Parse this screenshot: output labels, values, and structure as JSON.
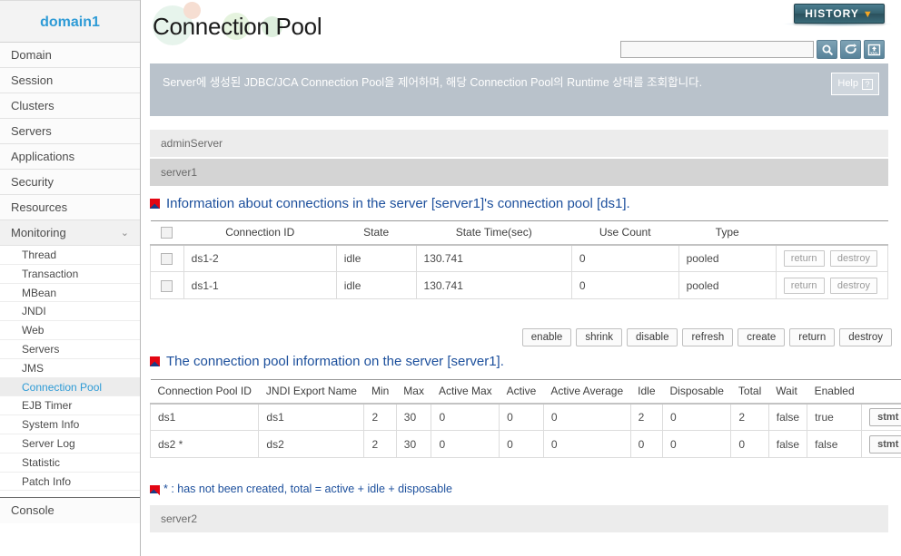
{
  "sidebar": {
    "domain_title": "domain1",
    "top_items": [
      {
        "label": "Domain"
      },
      {
        "label": "Session"
      },
      {
        "label": "Clusters"
      },
      {
        "label": "Servers"
      },
      {
        "label": "Applications"
      },
      {
        "label": "Security"
      },
      {
        "label": "Resources"
      }
    ],
    "monitoring": {
      "label": "Monitoring",
      "chevron": "⌄"
    },
    "sub_items": [
      {
        "label": "Thread",
        "active": false
      },
      {
        "label": "Transaction",
        "active": false
      },
      {
        "label": "MBean",
        "active": false
      },
      {
        "label": "JNDI",
        "active": false
      },
      {
        "label": "Web",
        "active": false
      },
      {
        "label": "Servers",
        "active": false
      },
      {
        "label": "JMS",
        "active": false
      },
      {
        "label": "Connection Pool",
        "active": true
      },
      {
        "label": "EJB Timer",
        "active": false
      },
      {
        "label": "System Info",
        "active": false
      },
      {
        "label": "Server Log",
        "active": false
      },
      {
        "label": "Statistic",
        "active": false
      },
      {
        "label": "Patch Info",
        "active": false
      }
    ],
    "console_label": "Console",
    "accent_color": "#2e9bd6"
  },
  "header": {
    "page_title": "Connection Pool",
    "history_label": "HISTORY",
    "history_caret": "▼",
    "search_value": "",
    "search_placeholder": "",
    "icons": [
      "search-icon",
      "refresh-icon",
      "xml-export-icon"
    ]
  },
  "notice": {
    "text": "Server에 생성된 JDBC/JCA Connection Pool을 제어하며, 해당 Connection Pool의 Runtime 상태를 조회합니다.",
    "help_label": "Help",
    "help_mark": "?"
  },
  "servers": {
    "admin": "adminServer",
    "server1": "server1",
    "server2": "server2"
  },
  "connections_section": {
    "heading": "Information about connections in the server [server1]'s connection pool [ds1].",
    "columns": [
      "",
      "Connection ID",
      "State",
      "State Time(sec)",
      "Use Count",
      "Type",
      ""
    ],
    "rows": [
      {
        "connection_id": "ds1-2",
        "state": "idle",
        "state_time": "130.741",
        "use_count": "0",
        "type": "pooled",
        "return_label": "return",
        "destroy_label": "destroy"
      },
      {
        "connection_id": "ds1-1",
        "state": "idle",
        "state_time": "130.741",
        "use_count": "0",
        "type": "pooled",
        "return_label": "return",
        "destroy_label": "destroy"
      }
    ]
  },
  "actions": [
    {
      "label": "enable"
    },
    {
      "label": "shrink"
    },
    {
      "label": "disable"
    },
    {
      "label": "refresh"
    },
    {
      "label": "create"
    },
    {
      "label": "return"
    },
    {
      "label": "destroy"
    }
  ],
  "pool_section": {
    "heading": "The connection pool information on the server [server1].",
    "columns": [
      "Connection Pool ID",
      "JNDI Export Name",
      "Min",
      "Max",
      "Active Max",
      "Active",
      "Active Average",
      "Idle",
      "Disposable",
      "Total",
      "Wait",
      "Enabled",
      ""
    ],
    "rows": [
      {
        "pool_id": "ds1",
        "jndi": "ds1",
        "min": "2",
        "max": "30",
        "active_max": "0",
        "active": "0",
        "active_avg": "0",
        "idle": "2",
        "disposable": "0",
        "total": "2",
        "wait": "false",
        "enabled": "true",
        "stmt_label": "stmt"
      },
      {
        "pool_id": "ds2 *",
        "jndi": "ds2",
        "min": "2",
        "max": "30",
        "active_max": "0",
        "active": "0",
        "active_avg": "0",
        "idle": "0",
        "disposable": "0",
        "total": "0",
        "wait": "false",
        "enabled": "false",
        "stmt_label": "stmt"
      }
    ]
  },
  "footnote": {
    "text": "* : has not been created, total = active + idle + disposable"
  }
}
